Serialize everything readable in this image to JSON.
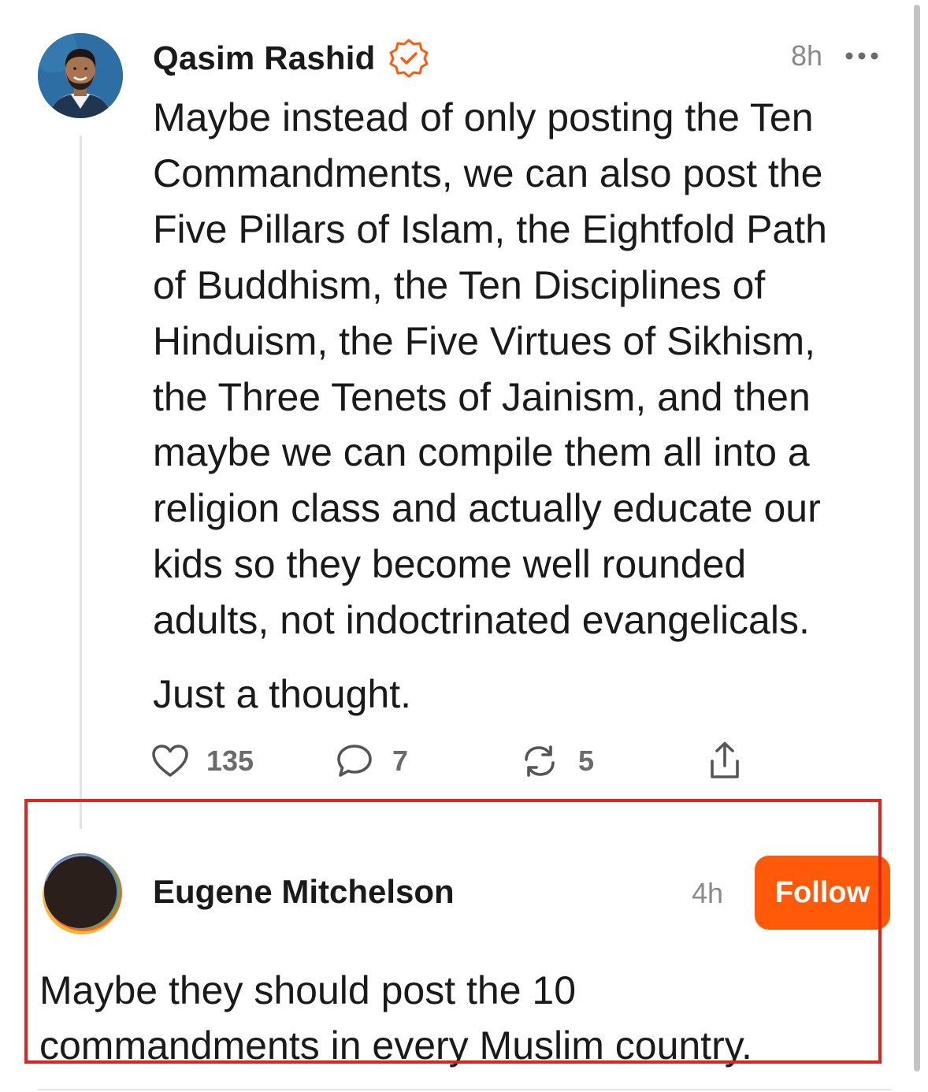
{
  "post": {
    "author": "Qasim Rashid",
    "verified_icon": "verified-badge-icon",
    "time": "8h",
    "more_icon": "more-options-icon",
    "text_lines": "Maybe instead of only posting the Ten\nCommandments, we can also post the\nFive Pillars of Islam, the Eightfold Path\nof Buddhism, the Ten Disciplines of\nHinduism, the Five Virtues of Sikhism,\nthe Three Tenets of Jainism, and then\nmaybe we can compile them all into a\nreligion class and actually educate our\nkids so they become well rounded\nadults, not indoctrinated evangelicals.",
    "text_2": "Just a thought.",
    "actions": {
      "likes": "135",
      "comments": "7",
      "restacks": "5"
    }
  },
  "reply": {
    "author": "Eugene Mitchelson",
    "time": "4h",
    "follow_label": "Follow",
    "text": "Maybe they should post the 10\ncommandments in every Muslim country."
  },
  "colors": {
    "accent": "#ff5a0a",
    "highlight_box": "#e0241b",
    "muted_text": "#8a8a8a"
  }
}
